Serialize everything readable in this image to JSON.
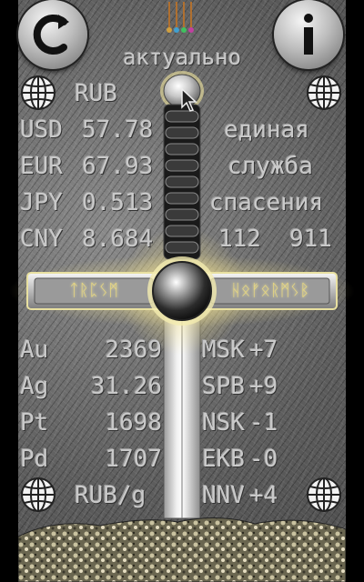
{
  "header": {
    "status": "актуально",
    "refresh_icon": "refresh-icon",
    "info_icon": "info-icon",
    "abacus_icon": "abacus-icon"
  },
  "currency": {
    "base": "RUB",
    "rates": [
      {
        "code": "USD",
        "value": "57.78"
      },
      {
        "code": "EUR",
        "value": "67.93"
      },
      {
        "code": "JPY",
        "value": "0.513"
      },
      {
        "code": "CNY",
        "value": "8.684"
      }
    ]
  },
  "emergency": {
    "line1": "единая",
    "line2": "служба",
    "line3": "спасения",
    "numbers": [
      "112",
      "911"
    ]
  },
  "runes": {
    "left": "ᛏᚱᛈᛊᛗ",
    "right": "ᚺᛟᚠᛟᚱᛗᛊᛒ"
  },
  "metals": {
    "unit": "RUB/g",
    "items": [
      {
        "code": "Au",
        "value": "2369"
      },
      {
        "code": "Ag",
        "value": "31.26"
      },
      {
        "code": "Pt",
        "value": "1698"
      },
      {
        "code": "Pd",
        "value": "1707"
      }
    ]
  },
  "timezones": {
    "items": [
      {
        "city": "MSK",
        "offset": "+7"
      },
      {
        "city": "SPB",
        "offset": "+9"
      },
      {
        "city": "NSK",
        "offset": "-1"
      },
      {
        "city": "EKB",
        "offset": "-0"
      },
      {
        "city": "NNV",
        "offset": "+4"
      }
    ]
  },
  "colors": {
    "text": "#c9c9c9",
    "glow": "#fff2a0",
    "gold": "#c8b060"
  }
}
